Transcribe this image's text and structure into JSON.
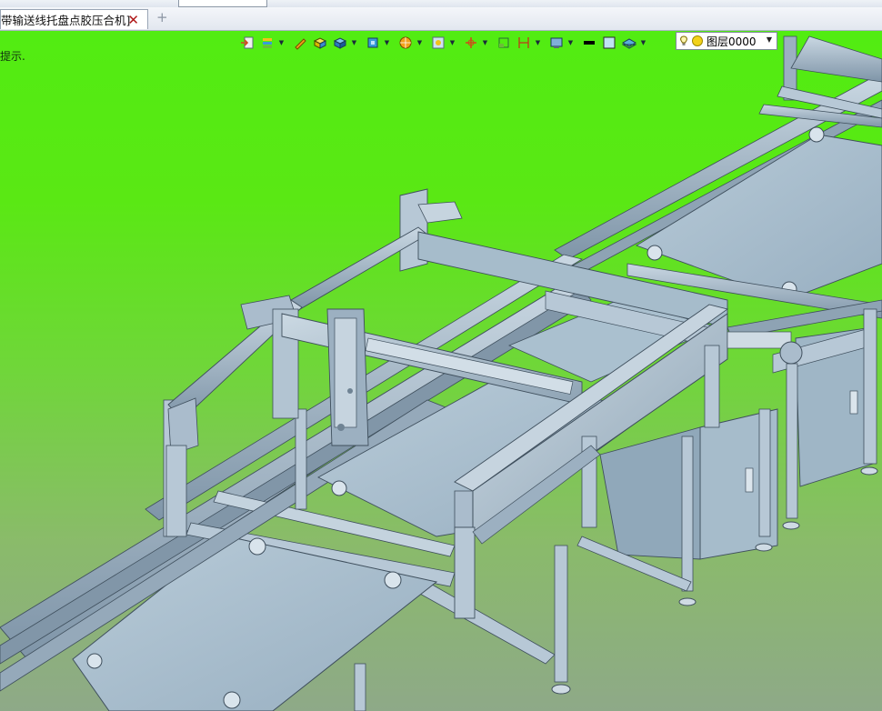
{
  "document_tab": {
    "title": "带输送线托盘点胶压合机]",
    "close_glyph": "✕",
    "add_glyph": "+"
  },
  "viewport": {
    "prompt_text": "提示.",
    "background_top": "#52ec12",
    "background_bottom": "#8ea988"
  },
  "view_toolbar": {
    "buttons": [
      {
        "icon": "import-icon"
      },
      {
        "icon": "layer-stack-icon"
      },
      {
        "icon": "pencil-icon"
      },
      {
        "icon": "cube-yellow-icon"
      },
      {
        "icon": "cube-blue-icon"
      },
      {
        "icon": "view-cube-icon"
      },
      {
        "icon": "render-ball-icon"
      },
      {
        "icon": "image-frame-icon"
      },
      {
        "icon": "axis-icon"
      },
      {
        "icon": "section-icon"
      },
      {
        "icon": "dimension-icon"
      },
      {
        "icon": "display-mode-icon"
      },
      {
        "icon": "line-color-icon"
      },
      {
        "icon": "fill-color-icon"
      },
      {
        "icon": "layer-sheet-icon"
      }
    ],
    "layer_combo": {
      "value": "图层0000",
      "bulb_icon": "lightbulb-icon",
      "state_icon": "sun-icon"
    }
  },
  "colors": {
    "frame_light": "#b7c8d6",
    "frame_mid": "#8fa4b6",
    "frame_dark": "#4d5f6e",
    "plate": "#a9bfcf",
    "cabinet": "#9fb6c6"
  }
}
